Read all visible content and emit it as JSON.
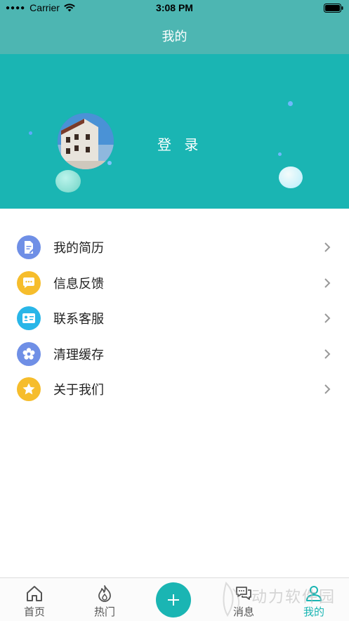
{
  "status_bar": {
    "carrier": "Carrier",
    "time": "3:08 PM"
  },
  "nav": {
    "title": "我的"
  },
  "profile": {
    "login_label": "登 录"
  },
  "menu": {
    "items": [
      {
        "label": "我的简历",
        "icon": "resume-icon",
        "color": "#6f8fe6"
      },
      {
        "label": "信息反馈",
        "icon": "feedback-chat-icon",
        "color": "#f6bd2c"
      },
      {
        "label": "联系客服",
        "icon": "contact-card-icon",
        "color": "#29b6e8"
      },
      {
        "label": "清理缓存",
        "icon": "clear-cache-gear-icon",
        "color": "#6f8fe6"
      },
      {
        "label": "关于我们",
        "icon": "star-icon",
        "color": "#f6bd2c"
      }
    ]
  },
  "tabs": [
    {
      "label": "首页",
      "icon": "home-icon"
    },
    {
      "label": "热门",
      "icon": "flame-icon"
    },
    {
      "label": "",
      "icon": "plus-icon"
    },
    {
      "label": "消息",
      "icon": "message-icon"
    },
    {
      "label": "我的",
      "icon": "person-icon",
      "active": true
    }
  ],
  "watermark": {
    "text": "动力软件园"
  },
  "colors": {
    "accent": "#1ab5b3",
    "nav_bg": "#4db6b2"
  }
}
